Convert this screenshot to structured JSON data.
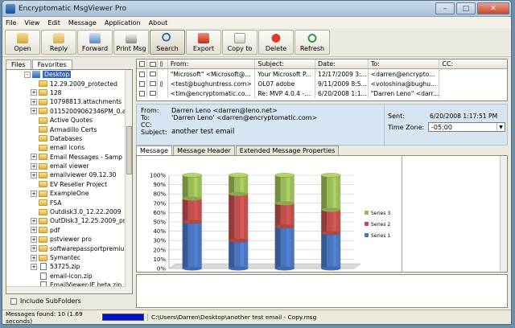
{
  "window": {
    "title": "Encryptomatic MsgViewer Pro"
  },
  "menu": [
    "File",
    "View",
    "Edit",
    "Message",
    "Application",
    "About"
  ],
  "toolbar": [
    {
      "label": "Open",
      "icon": "open-folder-icon"
    },
    {
      "label": "Reply",
      "icon": "reply-icon"
    },
    {
      "label": "Forward",
      "icon": "forward-icon"
    },
    {
      "label": "Print Msg",
      "icon": "printer-icon"
    },
    {
      "label": "Search",
      "icon": "magnifier-icon"
    },
    {
      "label": "Export",
      "icon": "export-icon"
    },
    {
      "label": "Copy to",
      "icon": "copy-icon"
    },
    {
      "label": "Delete",
      "icon": "delete-icon"
    },
    {
      "label": "Refresh",
      "icon": "refresh-icon"
    }
  ],
  "left_tabs": [
    "Files",
    "Favorites"
  ],
  "tree": [
    {
      "label": "Desktop",
      "type": "desktop",
      "selected": true,
      "exp": "-"
    },
    {
      "label": "12.29.2009_protected",
      "type": "folder",
      "exp": ""
    },
    {
      "label": "128",
      "type": "folder",
      "exp": "+"
    },
    {
      "label": "10798813.attachments",
      "type": "folder",
      "exp": "+"
    },
    {
      "label": "01152009062346PM_0.a",
      "type": "folder",
      "exp": "+"
    },
    {
      "label": "Active Quotes",
      "type": "folder",
      "exp": ""
    },
    {
      "label": "Armadillo Certs",
      "type": "folder",
      "exp": ""
    },
    {
      "label": "Databases",
      "type": "folder",
      "exp": ""
    },
    {
      "label": "email icons",
      "type": "folder",
      "exp": ""
    },
    {
      "label": "Email Messages - Samp",
      "type": "folder",
      "exp": "+"
    },
    {
      "label": "email viewer",
      "type": "folder",
      "exp": "+"
    },
    {
      "label": "emailviewer 09.12.30",
      "type": "folder",
      "exp": "+"
    },
    {
      "label": "EV Reseller Project",
      "type": "folder",
      "exp": ""
    },
    {
      "label": "ExampleOne",
      "type": "folder",
      "exp": "+"
    },
    {
      "label": "FSA",
      "type": "folder",
      "exp": ""
    },
    {
      "label": "Outdisk3.0_12.22.2009",
      "type": "folder",
      "exp": ""
    },
    {
      "label": "OutDisk3_12.25.2009_pr",
      "type": "folder",
      "exp": "+"
    },
    {
      "label": "pdf",
      "type": "folder",
      "exp": "+"
    },
    {
      "label": "pstviewer pro",
      "type": "folder",
      "exp": "+"
    },
    {
      "label": "softwarepassportpremiur",
      "type": "folder",
      "exp": "+"
    },
    {
      "label": "Symantec",
      "type": "folder",
      "exp": "+"
    },
    {
      "label": "53725.zip",
      "type": "file",
      "exp": "+"
    },
    {
      "label": "email-icon.zip",
      "type": "file",
      "exp": ""
    },
    {
      "label": "EmailViewer-IE beta.zip",
      "type": "file",
      "exp": ""
    }
  ],
  "include_subfolders": "Include SubFolders",
  "msglist": {
    "headers": [
      "From:",
      "Subject:",
      "Date:",
      "To:",
      "CC:"
    ],
    "rows": [
      {
        "from": "\"Microsoft\" <Microsoft@...",
        "subject": "Your Microsoft P...",
        "date": "12/17/2009 3:...",
        "to": "<darren@encrypto...",
        "cc": "",
        "attach": false
      },
      {
        "from": "<test@bughuntress.com>",
        "subject": "OL07 adobe",
        "date": "9/11/2009 8:5...",
        "to": "<voloshina@bughu...",
        "cc": "",
        "attach": true
      },
      {
        "from": "<tim@encryptomatic.co...",
        "subject": "Re: MVP 4.0.4 -...",
        "date": "6/20/2008 1:1...",
        "to": "\"Darren Leno\" <darr...",
        "cc": "",
        "attach": false
      }
    ]
  },
  "header": {
    "labels": {
      "from": "From:",
      "to": "To:",
      "cc": "CC:",
      "subject": "Subject:"
    },
    "from": "Darren Leno <darren@leno.net>",
    "to": "'Darren Leno' <darren@encryptomatic.com>",
    "cc": "",
    "subject": "another test email",
    "sent_label": "Sent:",
    "sent": "6/20/2008 1:17:51 PM",
    "tz_label": "Time Zone:",
    "tz": "-05:00"
  },
  "body_tabs": [
    "Message",
    "Message Header",
    "Extended Message Properties"
  ],
  "chart_data": {
    "type": "bar",
    "stacked": true,
    "style": "3d-cylinder",
    "percent": true,
    "categories": [
      "",
      "",
      "",
      ""
    ],
    "series": [
      {
        "name": "Series 1",
        "color": "#4a76c0",
        "values": [
          50,
          30,
          45,
          38
        ]
      },
      {
        "name": "Series 2",
        "color": "#c0504d",
        "values": [
          25,
          50,
          25,
          25
        ]
      },
      {
        "name": "Series 3",
        "color": "#9bbb59",
        "values": [
          25,
          20,
          30,
          37
        ]
      }
    ],
    "ylim": [
      0,
      100
    ],
    "yticks": [
      "0%",
      "10%",
      "20%",
      "30%",
      "40%",
      "50%",
      "60%",
      "70%",
      "80%",
      "90%",
      "100%"
    ],
    "legend": "right"
  },
  "status": {
    "text": "Messages found: 10 (1.69 seconds)",
    "progress": 1.0,
    "path": "C:\\Users\\Darren\\Desktop\\another test email - Copy.msg"
  }
}
